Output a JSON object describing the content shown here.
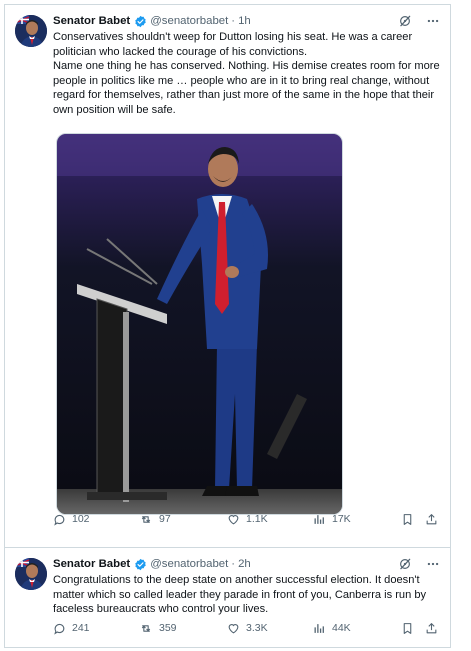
{
  "tweets": [
    {
      "author_name": "Senator Babet",
      "handle": "@senatorbabet",
      "separator": "·",
      "time": "1h",
      "text": "Conservatives shouldn't weep for Dutton losing his seat. He was a career politician who lacked the courage of his convictions.\nName one thing he has conserved. Nothing. His demise creates room for more people in politics like me … people who are in it to bring real change, without regard for themselves, rather than just more of the same in the hope that their own position will be safe.",
      "replies": "102",
      "reposts": "97",
      "likes": "1.1K",
      "views": "17K"
    },
    {
      "author_name": "Senator Babet",
      "handle": "@senatorbabet",
      "separator": "·",
      "time": "2h",
      "text": "Congratulations to the deep state on another successful election. It doesn't matter which so called leader they parade in front of you, Canberra is run by faceless bureaucrats who control your lives.",
      "replies": "241",
      "reposts": "359",
      "likes": "3.3K",
      "views": "44K"
    }
  ],
  "icons": {
    "verified": "verified-badge-icon",
    "grok": "grok-icon",
    "more": "more-icon",
    "reply": "reply-icon",
    "repost": "repost-icon",
    "like": "like-icon",
    "views": "views-icon",
    "bookmark": "bookmark-icon",
    "share": "share-icon"
  },
  "colors": {
    "text": "#0f1419",
    "secondary": "#536471",
    "verified": "#1d9bf0",
    "border": "#cfd9de"
  }
}
